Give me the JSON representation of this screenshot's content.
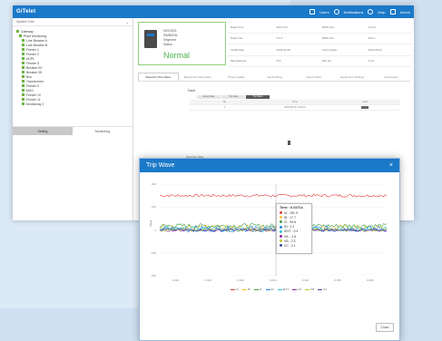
{
  "app": {
    "logo": "GiTelet",
    "topbar_items": [
      "Users",
      "Notifications",
      "Help",
      "Admin"
    ]
  },
  "sidebar": {
    "header": "System Tree",
    "tree": [
      {
        "label": "Gateway",
        "level": 0
      },
      {
        "label": "Plant Monitoring",
        "level": 1
      },
      {
        "label": "Line Breaker A",
        "level": 2
      },
      {
        "label": "Line Breaker B",
        "level": 2
      },
      {
        "label": "Feeder 1",
        "level": 2
      },
      {
        "label": "Feeder 2",
        "level": 2
      },
      {
        "label": "ADPL",
        "level": 2
      },
      {
        "label": "Feeder 5",
        "level": 2
      },
      {
        "label": "Breaker 04",
        "level": 2
      },
      {
        "label": "Breaker 05",
        "level": 2
      },
      {
        "label": "Bus",
        "level": 2
      },
      {
        "label": "Transformer",
        "level": 2
      },
      {
        "label": "Feeder 9",
        "level": 2
      },
      {
        "label": "MSG",
        "level": 2
      },
      {
        "label": "Feeder 10",
        "level": 2
      },
      {
        "label": "Feeder 11",
        "level": 2
      },
      {
        "label": "Monitoring 2",
        "level": 2
      }
    ],
    "tabs": [
      {
        "label": "Setting",
        "active": true
      },
      {
        "label": "Monitoring",
        "active": false
      }
    ]
  },
  "device": {
    "line1": "NSX252L",
    "line2": "SWBD01L",
    "line3": "Segment",
    "line4": "Status",
    "status": "Normal",
    "status_color": "#4caf50"
  },
  "info_table": [
    [
      "Rated Curr.",
      "250.0 KV",
      "RMS Curr.",
      "12.5 A"
    ],
    [
      "Peak Curr.",
      "0.0 A",
      "RMS Volt.",
      "230 V"
    ],
    [
      "Install Date",
      "2023-01-05",
      "Last Update",
      "2023-08-12"
    ],
    [
      "Manufacturer",
      "ISO",
      "HW Ver.",
      "1.0.2"
    ]
  ],
  "tabs": [
    {
      "label": "Waveform/Trip Wave",
      "active": true
    },
    {
      "label": "Equipment Information",
      "active": false
    },
    {
      "label": "Power Quality",
      "active": false
    },
    {
      "label": "Fault History",
      "active": false
    },
    {
      "label": "Report Data",
      "active": false
    },
    {
      "label": "Equipment Settings",
      "active": false
    },
    {
      "label": "Load Graph",
      "active": false
    }
  ],
  "trip_section": {
    "title": "Fault",
    "mini_tabs": [
      {
        "label": "Event Data",
        "active": false
      },
      {
        "label": "Trip Data",
        "active": false
      },
      {
        "label": "Trip Wave",
        "active": true
      }
    ],
    "table_headers": [
      "No.",
      "Time",
      "View"
    ],
    "rows": [
      [
        "1",
        "2023-08-12 14:05:13",
        ""
      ]
    ]
  },
  "section2_title": "Segment Data",
  "modal": {
    "title": "Trip Wave",
    "close_label": "×",
    "button": "Close",
    "ylabel": "Value",
    "tooltip": {
      "title": "Time : 0.0271s",
      "rows": [
        {
          "label": "IA : 151.9",
          "color": "#e53935"
        },
        {
          "label": "IB : 17.7",
          "color": "#fbc02d"
        },
        {
          "label": "IC : 94.6",
          "color": "#43a047"
        },
        {
          "label": "IN : 2.2",
          "color": "#1e88e5"
        },
        {
          "label": "IEXT : 0.4",
          "color": "#26c6da"
        },
        {
          "label": "VA : -1.6",
          "color": "#8e24aa"
        },
        {
          "label": "VB : 2.3",
          "color": "#c0ca33"
        },
        {
          "label": "VC : 2.1",
          "color": "#3949ab"
        }
      ]
    }
  },
  "chart_data": {
    "type": "line",
    "ylabel": "Value",
    "yticks": [
      "200",
      "100",
      "0",
      "-100",
      "-200"
    ],
    "xticks": [
      "0.000",
      "0.010",
      "0.020",
      "0.030",
      "0.040",
      "0.050",
      "0.060"
    ],
    "ylim": [
      -200,
      200
    ],
    "xlim": [
      0,
      0.07
    ],
    "legend_position": "bottom",
    "series": [
      {
        "name": "IA",
        "color": "#e53935",
        "level": 150,
        "amp": 6
      },
      {
        "name": "IB",
        "color": "#fbc02d",
        "level": 10,
        "amp": 12
      },
      {
        "name": "IC",
        "color": "#43a047",
        "level": 18,
        "amp": 10
      },
      {
        "name": "IN",
        "color": "#1e88e5",
        "level": 5,
        "amp": 14
      },
      {
        "name": "IEXT",
        "color": "#26c6da",
        "level": 2,
        "amp": 12
      },
      {
        "name": "VA",
        "color": "#8e24aa",
        "level": -2,
        "amp": 5
      },
      {
        "name": "VB",
        "color": "#c0ca33",
        "level": 0,
        "amp": 6
      },
      {
        "name": "VC",
        "color": "#3949ab",
        "level": 1,
        "amp": 6
      }
    ]
  }
}
